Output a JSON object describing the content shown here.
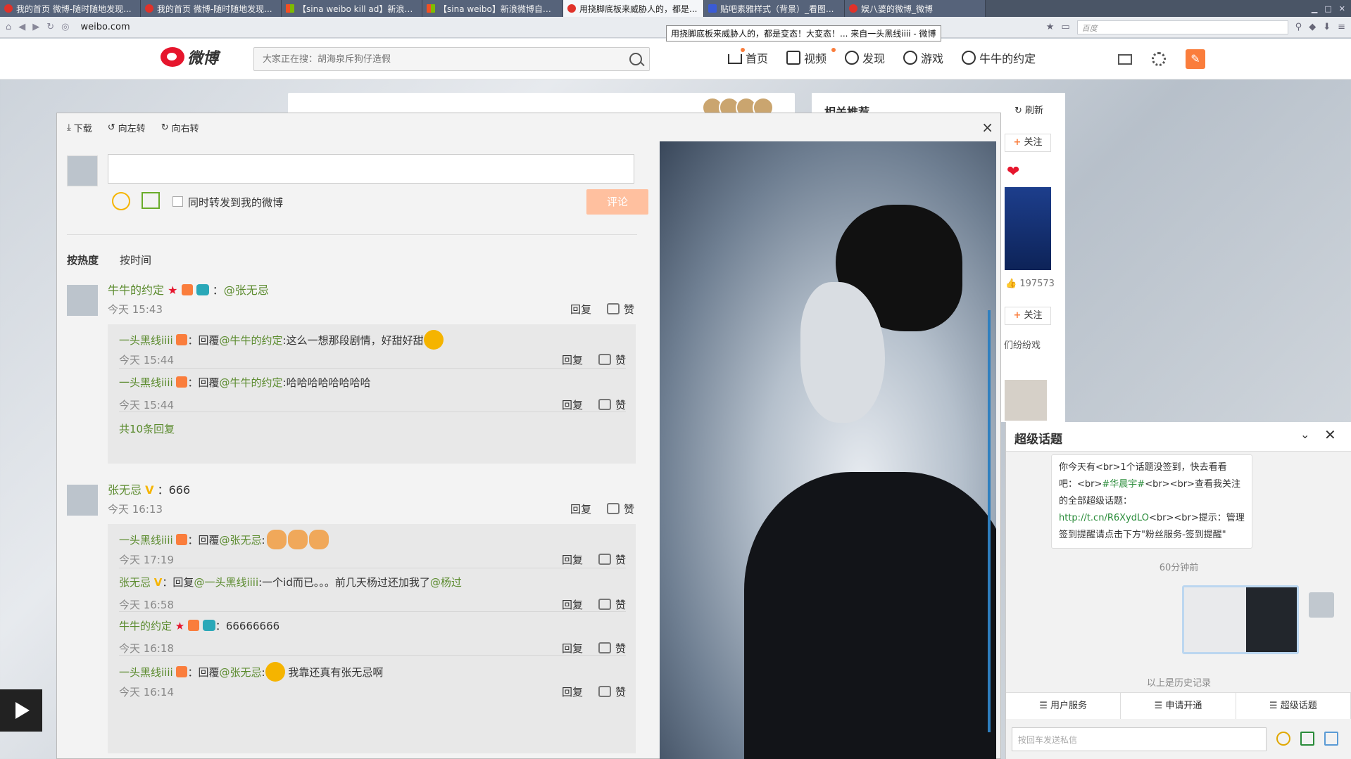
{
  "browser": {
    "tabs": [
      {
        "label": "我的首页 微博-随时随地发现..."
      },
      {
        "label": "我的首页 微博-随时随地发现..."
      },
      {
        "label": "【sina weibo kill ad】新浪微..."
      },
      {
        "label": "【sina weibo】新浪微博自定..."
      },
      {
        "label": "用挠脚底板来威胁人的，都是..."
      },
      {
        "label": "贴吧素雅样式（背景）_看图..."
      },
      {
        "label": "娱八婆的微博_微博"
      }
    ],
    "url": "weibo.com",
    "tooltip": "用挠脚底板来威胁人的，都是变态！大变态！... 来自一头黑线iiii - 微博",
    "search_engine": "百度"
  },
  "header": {
    "logo_text": "微博",
    "search_placeholder": "大家正在搜：胡海泉斥狗仔造假",
    "nav": [
      "首页",
      "视频",
      "发现",
      "游戏",
      "牛牛的约定"
    ]
  },
  "recommend": {
    "title": "相关推荐",
    "refresh": "刷新",
    "follow": "关注",
    "count": "197573",
    "text": "们纷纷戏"
  },
  "viewer": {
    "toolbar": {
      "download": "下载",
      "rotate_left": "向左转",
      "rotate_right": "向右转"
    },
    "close": "×",
    "forward_label": "同时转发到我的微博",
    "submit": "评论",
    "sort": {
      "hot": "按热度",
      "time": "按时间"
    },
    "actions": {
      "reply": "回复",
      "like": "赞"
    },
    "comments": [
      {
        "name": "牛牛的约定",
        "text": "@张无忌",
        "time": "今天 15:43",
        "replies": [
          {
            "name": "一头黑线iiii",
            "prefix": "回覆",
            "mention": "@牛牛的约定",
            "text": "这么一想那段剧情，好甜好甜",
            "time": "今天 15:44"
          },
          {
            "name": "一头黑线iiii",
            "prefix": "回覆",
            "mention": "@牛牛的约定",
            "text": "哈哈哈哈哈哈哈哈",
            "time": "今天 15:44"
          }
        ],
        "more": "共10条回复"
      },
      {
        "name": "张无忌",
        "text": "666",
        "time": "今天 16:13",
        "replies": [
          {
            "name": "一头黑线iiii",
            "prefix": "回覆",
            "mention": "@张无忌",
            "text": "",
            "time": "今天 17:19"
          },
          {
            "name": "张无忌",
            "prefix": "回复",
            "mention": "@一头黑线iiii",
            "text": "一个id而已。。。前几天杨过还加我了",
            "mention2": "@杨过",
            "time": "今天 16:58"
          },
          {
            "name": "牛牛的约定",
            "prefix": "",
            "mention": "",
            "text": "66666666",
            "time": "今天 16:18"
          },
          {
            "name": "一头黑线iiii",
            "prefix": "回覆",
            "mention": "@张无忌",
            "text": "我靠还真有张无忌啊",
            "time": "今天 16:14"
          }
        ]
      }
    ]
  },
  "chat": {
    "title": "超级话题",
    "message": {
      "l1": "你今天有<br>1个话题没签到，快去看看吧：<br>",
      "topic": "#华晨宇#",
      "l2": "<br><br>查看我关注的全部超级话题：",
      "link": "http://t.cn/R6XydLO",
      "l3": "<br><br>提示：管理签到提醒请点击下方\"粉丝服务-签到提醒\""
    },
    "time": "60分钟前",
    "history": "以上是历史记录",
    "menu": [
      "用户服务",
      "申请开通",
      "超级话题"
    ],
    "input_placeholder": "按回车发送私信"
  },
  "colors": {
    "brand": "#e6162d",
    "accent": "#fa7d3c",
    "name_green": "#5b8b2e"
  }
}
